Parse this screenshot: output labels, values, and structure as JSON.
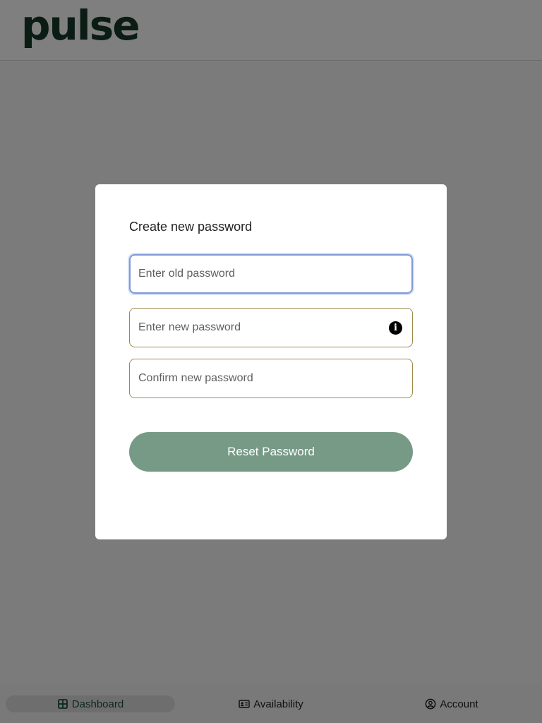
{
  "app": {
    "logo_text": "pulse",
    "brand_color": "#163829"
  },
  "modal": {
    "title": "Create new password",
    "old_password_placeholder": "Enter old password",
    "new_password_placeholder": "Enter new password",
    "confirm_password_placeholder": "Confirm new password",
    "info_icon": "info-icon",
    "reset_button_label": "Reset Password",
    "button_color": "#779a87"
  },
  "bottom_nav": {
    "items": [
      {
        "label": "Dashboard",
        "icon": "grid-icon",
        "active": true
      },
      {
        "label": "Availability",
        "icon": "id-card-icon",
        "active": false
      },
      {
        "label": "Account",
        "icon": "user-circle-icon",
        "active": false
      }
    ]
  }
}
